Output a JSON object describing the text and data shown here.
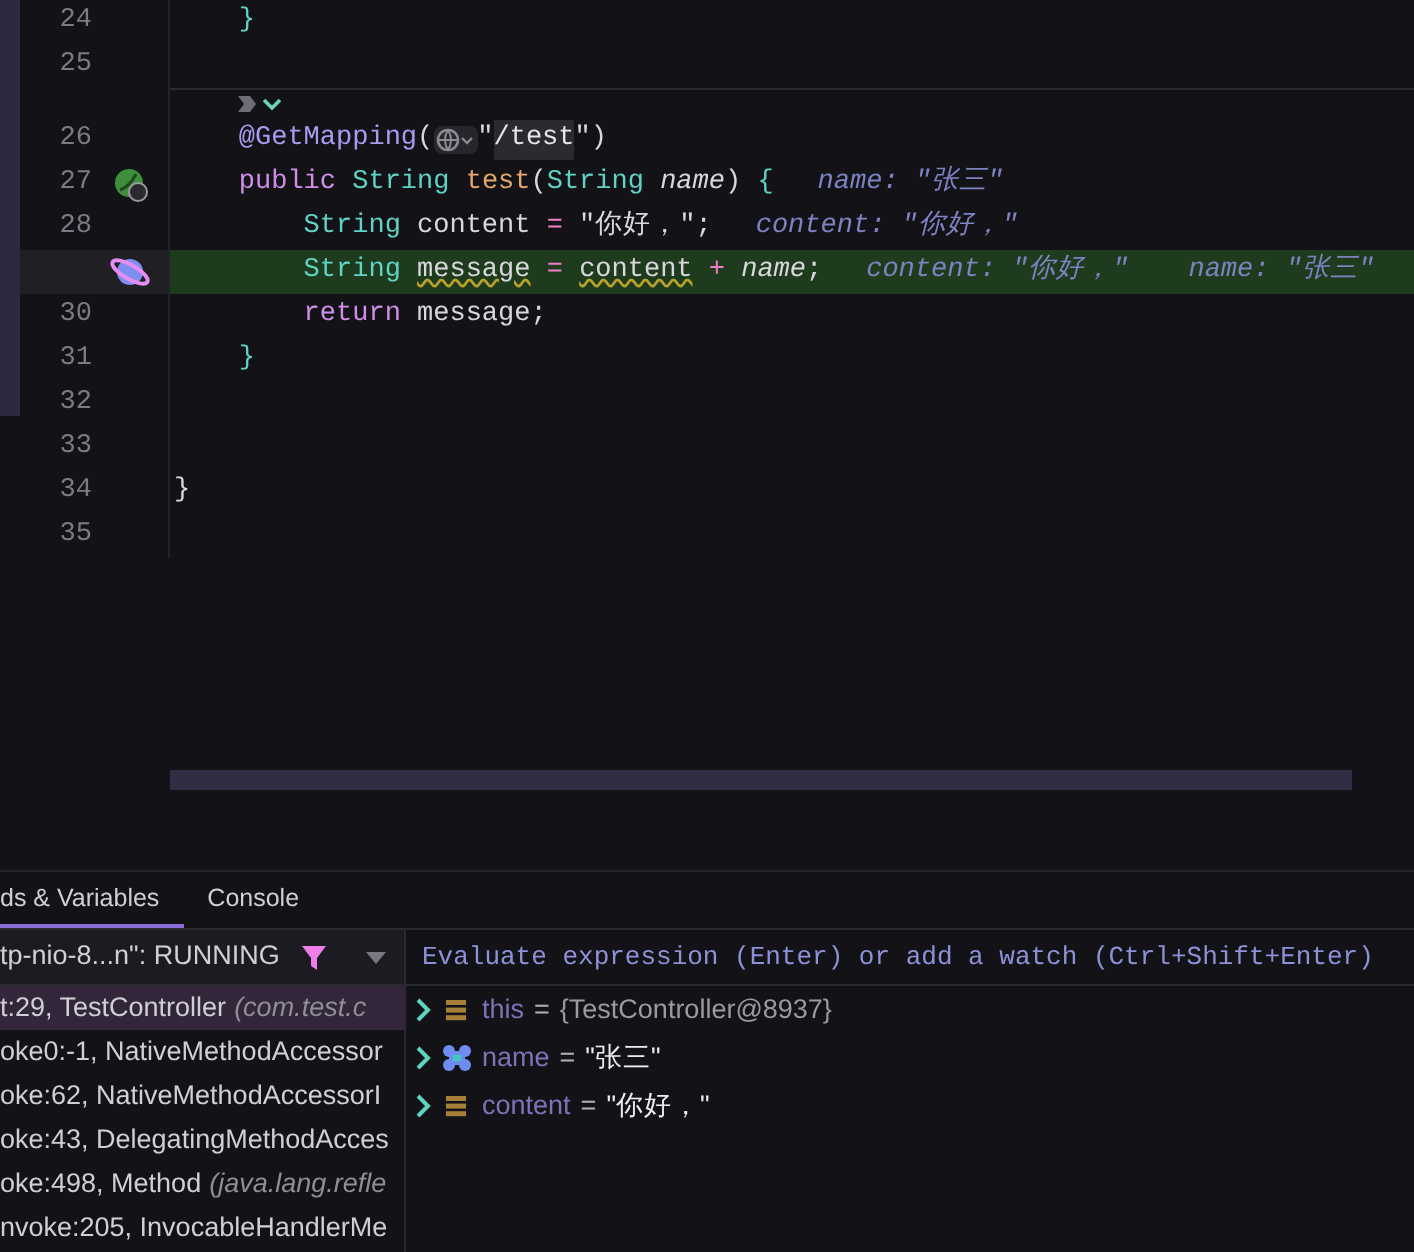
{
  "editor": {
    "lines": [
      {
        "kind": "code",
        "number": "24",
        "current": false,
        "tokens": [
          {
            "kind": "brace",
            "text": "    }"
          }
        ]
      },
      {
        "kind": "code",
        "number": "25",
        "current": false
      },
      {
        "kind": "inlay"
      },
      {
        "kind": "code",
        "number": "26",
        "current": false,
        "tokens": [
          {
            "kind": "annotation",
            "text": "    @GetMapping"
          },
          {
            "kind": "plain",
            "text": "("
          },
          {
            "kind": "globe"
          },
          {
            "kind": "plain",
            "text": "\""
          },
          {
            "kind": "url",
            "text": "/test"
          },
          {
            "kind": "plain",
            "text": "\")"
          }
        ]
      },
      {
        "kind": "bean",
        "number": "27",
        "current": false,
        "tokens": [
          {
            "kind": "keyword",
            "text": "    public "
          },
          {
            "kind": "type",
            "text": "String "
          },
          {
            "kind": "method",
            "text": "test"
          },
          {
            "kind": "plain",
            "text": "("
          },
          {
            "kind": "type",
            "text": "String "
          },
          {
            "kind": "param",
            "text": "name"
          },
          {
            "kind": "plain",
            "text": ") "
          },
          {
            "kind": "brace",
            "text": "{"
          }
        ],
        "hints": [
          {
            "label": "name:",
            "value": "\"张三\""
          }
        ]
      },
      {
        "kind": "code",
        "number": "28",
        "current": false,
        "tokens": [
          {
            "kind": "type",
            "text": "        String "
          },
          {
            "kind": "plain",
            "text": "content "
          },
          {
            "kind": "operator",
            "text": "= "
          },
          {
            "kind": "plain",
            "text": "\"你好，\";"
          }
        ],
        "hints": [
          {
            "label": "content:",
            "value": "\"你好，\""
          }
        ]
      },
      {
        "kind": "breakpoint",
        "current": true,
        "tokens": [
          {
            "kind": "type",
            "text": "        String "
          },
          {
            "kind": "warn",
            "text": "message"
          },
          {
            "kind": "operator",
            "text": " = "
          },
          {
            "kind": "warn",
            "text": "content"
          },
          {
            "kind": "operator",
            "text": " + "
          },
          {
            "kind": "param",
            "text": "name"
          },
          {
            "kind": "plain",
            "text": ";"
          }
        ],
        "hints": [
          {
            "label": "content:",
            "value": "\"你好，\""
          },
          {
            "label": "name:",
            "value": "\"张三\""
          }
        ]
      },
      {
        "kind": "code",
        "number": "30",
        "current": false,
        "tokens": [
          {
            "kind": "keyword",
            "text": "        return "
          },
          {
            "kind": "plain",
            "text": "message;"
          }
        ]
      },
      {
        "kind": "code",
        "number": "31",
        "current": false,
        "tokens": [
          {
            "kind": "brace",
            "text": "    }"
          }
        ]
      },
      {
        "kind": "code",
        "number": "32",
        "current": false
      },
      {
        "kind": "code",
        "number": "33",
        "current": false
      },
      {
        "kind": "code",
        "number": "34",
        "current": false,
        "tokens": [
          {
            "kind": "plain",
            "text": "}"
          }
        ]
      },
      {
        "kind": "code",
        "number": "35",
        "current": false
      }
    ]
  },
  "debugger": {
    "tabs": [
      {
        "label": "ds & Variables",
        "selected": true
      },
      {
        "label": "Console",
        "selected": false
      }
    ],
    "thread": "tp-nio-8...n\": RUNNING",
    "frames": [
      {
        "text": "t:29, TestController",
        "package": "(com.test.c",
        "selected": true
      },
      {
        "text": "oke0:-1, NativeMethodAccessor",
        "selected": false
      },
      {
        "text": "oke:62, NativeMethodAccessorI",
        "selected": false
      },
      {
        "text": "oke:43, DelegatingMethodAcces",
        "selected": false
      },
      {
        "text": "oke:498, Method",
        "package": "(java.lang.refle",
        "selected": false
      },
      {
        "text": "nvoke:205, InvocableHandlerMe",
        "selected": false
      }
    ],
    "evaluate_placeholder": "Evaluate expression (Enter) or add a watch (Ctrl+Shift+Enter)",
    "variables": [
      {
        "kind": "field",
        "name": "this",
        "operator": "=",
        "value": "{TestController@8937}"
      },
      {
        "kind": "param",
        "name": "name",
        "operator": "=",
        "value": "\"张三\""
      },
      {
        "kind": "field",
        "name": "content",
        "operator": "=",
        "value": "\"你好，\""
      }
    ]
  }
}
